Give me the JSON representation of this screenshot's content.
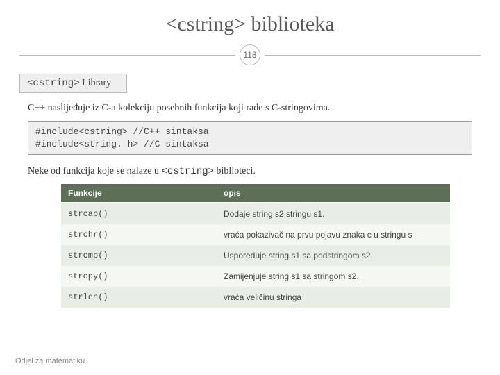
{
  "title": "<cstring> biblioteka",
  "page_number": "118",
  "section_label": {
    "mono": "<cstring>",
    "rest": " Library"
  },
  "intro": "C++ naslijeđuje iz C-a kolekciju posebnih funkcija koji rade s C-stringovima.",
  "code_lines": [
    "#include<cstring> //C++ sintaksa",
    "#include<string. h> //C sintaksa"
  ],
  "mid_text": {
    "pre": "Neke od funkcija koje se nalaze u ",
    "mono": "<cstring>",
    "post": " biblioteci."
  },
  "table": {
    "headers": [
      "Funkcije",
      "opis"
    ],
    "rows": [
      {
        "fn": "strcap()",
        "desc": "Dodaje string s2 stringu s1."
      },
      {
        "fn": "strchr()",
        "desc": "vraća pokazivač na prvu pojavu znaka c u stringu s"
      },
      {
        "fn": "strcmp()",
        "desc": "Uspoređuje string s1 sa podstringom s2."
      },
      {
        "fn": "strcpy()",
        "desc": "Zamijenjuje string s1 sa stringom s2."
      },
      {
        "fn": "strlen()",
        "desc": "vraća veličinu stringa"
      }
    ]
  },
  "footer": "Odjel za matematiku"
}
